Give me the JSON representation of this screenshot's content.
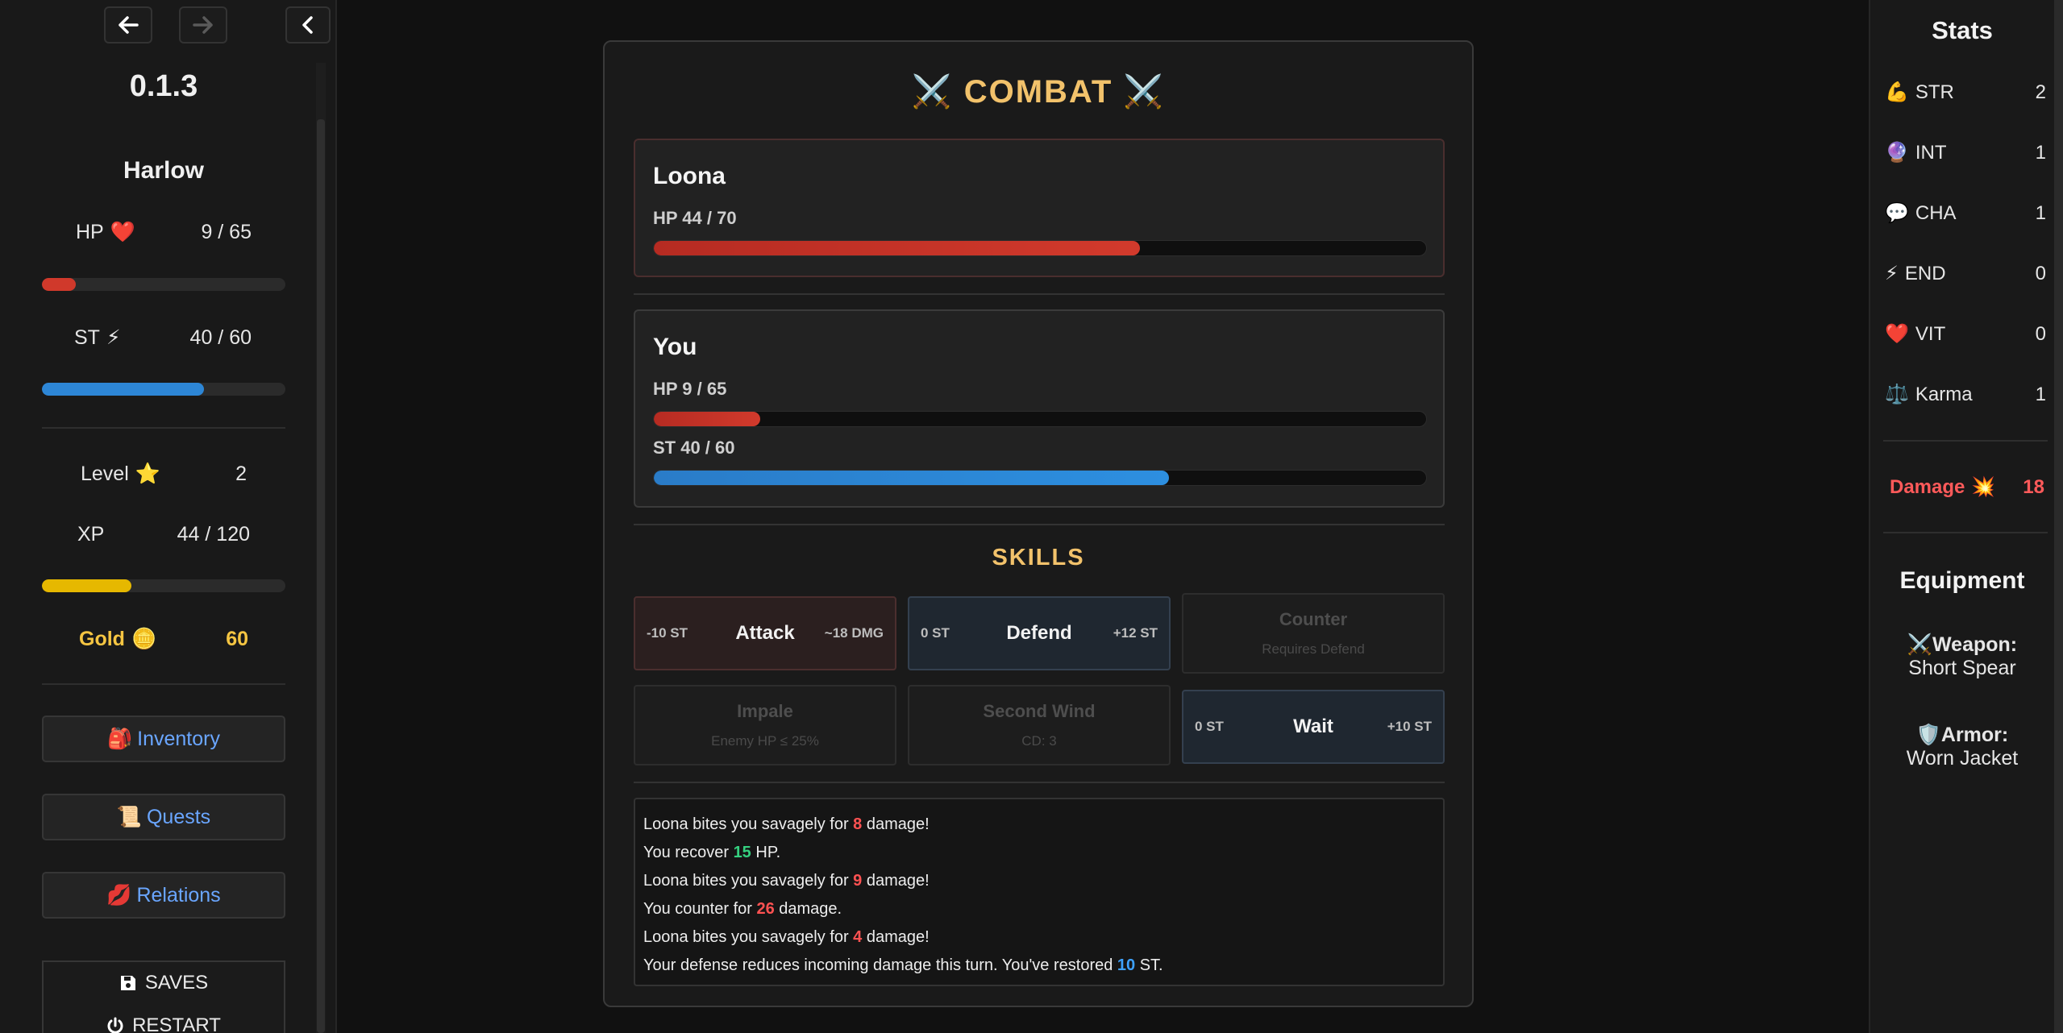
{
  "app": {
    "version": "0.1.3"
  },
  "player": {
    "name": "Harlow",
    "hp": {
      "label": "HP",
      "icon": "❤️",
      "text": "9 / 65",
      "fraction": 0.138
    },
    "st": {
      "label": "ST",
      "icon": "⚡",
      "text": "40 / 60",
      "fraction": 0.667
    },
    "level": {
      "label": "Level",
      "icon": "⭐",
      "value": "2"
    },
    "xp": {
      "label": "XP",
      "text": "44 / 120",
      "fraction": 0.367
    },
    "gold": {
      "label": "Gold",
      "icon": "🪙",
      "value": "60"
    }
  },
  "menu": {
    "inventory": {
      "icon": "🎒",
      "label": "Inventory"
    },
    "quests": {
      "icon": "📜",
      "label": "Quests"
    },
    "relations": {
      "icon": "💋",
      "label": "Relations"
    },
    "saves": {
      "label": "SAVES"
    },
    "restart": {
      "label": "RESTART"
    }
  },
  "combat": {
    "title": "⚔️ COMBAT ⚔️",
    "enemy": {
      "name": "Loona",
      "hp_label": "HP  44 / 70",
      "hp_fraction": 0.629
    },
    "you": {
      "name": "You",
      "hp_label": "HP  9 / 65",
      "hp_fraction": 0.138,
      "st_label": "ST  40 / 60",
      "st_fraction": 0.667
    },
    "skills_title": "SKILLS",
    "skills": {
      "attack": {
        "cost": "-10 ST",
        "name": "Attack",
        "effect": "~18 DMG"
      },
      "defend": {
        "cost": "0 ST",
        "name": "Defend",
        "effect": "+12 ST"
      },
      "counter": {
        "name": "Counter",
        "sub": "Requires Defend"
      },
      "impale": {
        "name": "Impale",
        "sub": "Enemy HP ≤ 25%"
      },
      "second_wind": {
        "name": "Second Wind",
        "sub": "CD: 3"
      },
      "wait": {
        "cost": "0 ST",
        "name": "Wait",
        "effect": "+10 ST"
      }
    },
    "log": [
      {
        "pre": "Loona bites you savagely for ",
        "num": "8",
        "post": " damage!",
        "kind": "r"
      },
      {
        "pre": "You recover ",
        "num": "15",
        "post": " HP.",
        "kind": "g"
      },
      {
        "pre": "Loona bites you savagely for ",
        "num": "9",
        "post": " damage!",
        "kind": "r"
      },
      {
        "pre": "You counter for ",
        "num": "26",
        "post": " damage.",
        "kind": "r"
      },
      {
        "pre": "Loona bites you savagely for ",
        "num": "4",
        "post": " damage!",
        "kind": "r"
      },
      {
        "pre": "Your defense reduces incoming damage this turn. You've restored ",
        "num": "10",
        "post": " ST.",
        "kind": "b"
      }
    ]
  },
  "stats": {
    "title": "Stats",
    "items": [
      {
        "icon": "💪",
        "label": "STR",
        "value": "2"
      },
      {
        "icon": "🔮",
        "label": "INT",
        "value": "1"
      },
      {
        "icon": "💬",
        "label": "CHA",
        "value": "1"
      },
      {
        "icon": "⚡",
        "label": "END",
        "value": "0"
      },
      {
        "icon": "❤️",
        "label": "VIT",
        "value": "0"
      },
      {
        "icon": "⚖️",
        "label": "Karma",
        "value": "1"
      }
    ],
    "damage": {
      "label": "Damage",
      "icon": "💥",
      "value": "18"
    }
  },
  "equipment": {
    "title": "Equipment",
    "weapon": {
      "label": "⚔️Weapon:",
      "value": "Short Spear"
    },
    "armor": {
      "label": "🛡️Armor:",
      "value": "Worn Jacket"
    }
  },
  "colors": {
    "hp": "#c0392b",
    "st": "#2d86d6",
    "xp": "#e6b800",
    "gold": "#f5c542",
    "accent": "#f2c26b",
    "link": "#6aa6ff"
  }
}
